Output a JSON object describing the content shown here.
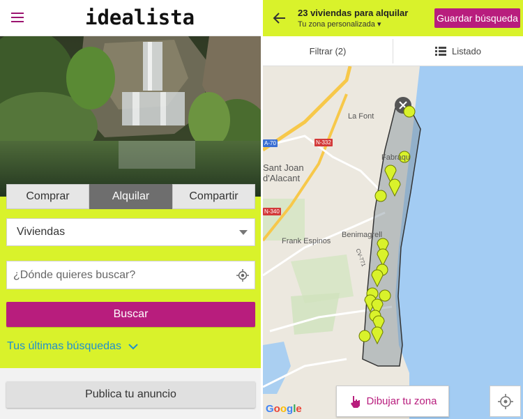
{
  "left_screen": {
    "brand": "idealista",
    "tabs": [
      "Comprar",
      "Alquilar",
      "Compartir"
    ],
    "active_tab": "Alquilar",
    "property_type": "Viviendas",
    "search_placeholder": "¿Dónde quieres buscar?",
    "search_button": "Buscar",
    "recent_searches": "Tus últimas búsquedas",
    "publish_button": "Publica tu anuncio"
  },
  "right_screen": {
    "title": "23 viviendas para alquilar",
    "subtitle": "Tu zona personalizada ▾",
    "save_button": "Guardar búsqueda",
    "filter_button": "Filtrar (2)",
    "list_button": "Listado",
    "map_labels": {
      "la_font": "La Font",
      "fabraquer": "Fabraqu",
      "sant_joan_1": "Sant Joan",
      "sant_joan_2": "d'Alacant",
      "benimagrell": "Benimagrell",
      "frank_espinos": "Frank Espinos",
      "cv771": "CV-771"
    },
    "road_signs": {
      "a70": "A-70",
      "n332": "N-332",
      "n340": "N-340"
    },
    "draw_zone_button": "Dibujar tu zona",
    "map_attribution": "Google"
  },
  "colors": {
    "accent_lime": "#d9f22b",
    "brand_magenta": "#b81d7d",
    "link_blue": "#1f8fcf",
    "sea": "#a3ccf3",
    "marker": "#d9f22b"
  },
  "icons": {
    "menu": "hamburger-icon",
    "locate": "crosshair-icon",
    "chevron": "chevron-down-icon",
    "back": "arrow-left-icon",
    "list": "list-icon",
    "draw": "hand-pointer-icon",
    "close": "close-icon"
  }
}
